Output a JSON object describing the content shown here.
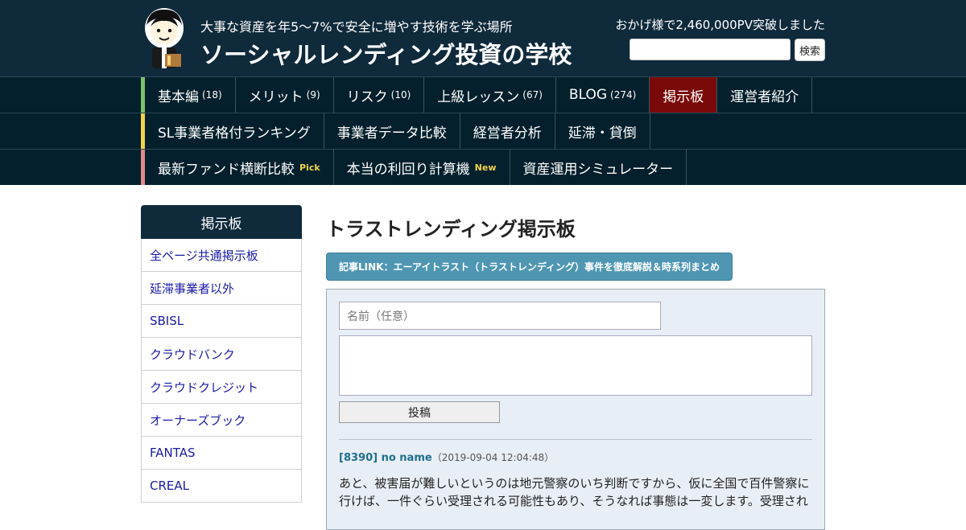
{
  "header": {
    "tagline": "大事な資産を年5～7%で安全に増やす技術を学ぶ場所",
    "title": "ソーシャルレンディング投資の学校",
    "pv_notice": "おかげ様で2,460,000PV突破しました",
    "search_button": "検索"
  },
  "nav": {
    "row1": [
      {
        "label": "基本編",
        "count": "(18)"
      },
      {
        "label": "メリット",
        "count": "(9)"
      },
      {
        "label": "リスク",
        "count": "(10)"
      },
      {
        "label": "上級レッスン",
        "count": "(67)"
      },
      {
        "label": "BLOG",
        "count": "(274)"
      },
      {
        "label": "掲示板",
        "count": ""
      },
      {
        "label": "運営者紹介",
        "count": ""
      }
    ],
    "row2": [
      {
        "label": "SL事業者格付ランキング"
      },
      {
        "label": "事業者データ比較"
      },
      {
        "label": "経営者分析"
      },
      {
        "label": "延滞・貸倒"
      }
    ],
    "row3": [
      {
        "label": "最新ファンド横断比較",
        "tag": "Pick"
      },
      {
        "label": "本当の利回り計算機",
        "tag": "New"
      },
      {
        "label": "資産運用シミュレーター",
        "tag": ""
      }
    ],
    "accent_colors": [
      "#7cc26a",
      "#f2d24b",
      "#e28a8a"
    ]
  },
  "sidebar": {
    "heading": "掲示板",
    "items": [
      "全ページ共通掲示板",
      "延滞事業者以外",
      "SBISL",
      "クラウドバンク",
      "クラウドクレジット",
      "オーナーズブック",
      "FANTAS",
      "CREAL"
    ]
  },
  "main": {
    "title": "トラストレンディング掲示板",
    "link_button": "記事LINK：エーアイトラスト（トラストレンディング）事件を徹底解説＆時系列まとめ",
    "form": {
      "name_placeholder": "名前（任意）",
      "post_button": "投稿"
    },
    "post": {
      "id_name": "[8390] no name",
      "date": "（2019-09-04 12:04:48）",
      "body": "あと、被害届が難しいというのは地元警察のいち判断ですから、仮に全国で百件警察に行けば、一件ぐらい受理される可能性もあり、そうなれば事態は一変します。受理され"
    }
  }
}
